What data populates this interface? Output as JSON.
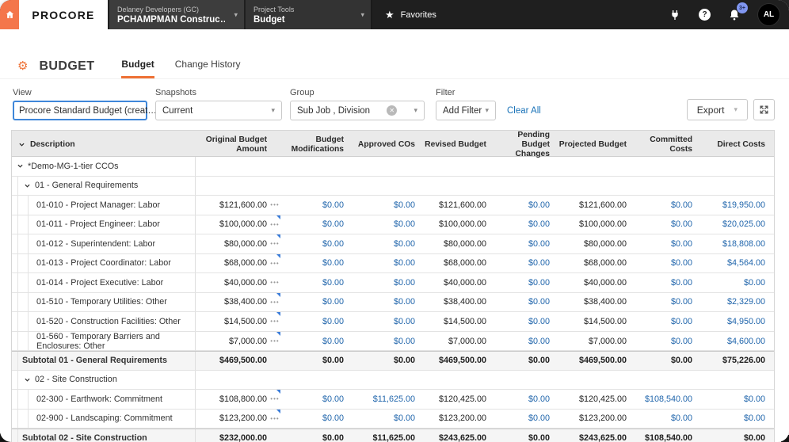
{
  "topbar": {
    "logo": "PROCORE",
    "company_label": "Delaney Developers (GC)",
    "company_value": "PCHAMPMAN Construc…",
    "tools_label": "Project Tools",
    "tools_value": "Budget",
    "favorites": "Favorites",
    "notification_badge": "3+",
    "avatar_initials": "AL"
  },
  "page": {
    "title": "BUDGET",
    "tabs": [
      {
        "label": "Budget",
        "active": true
      },
      {
        "label": "Change History",
        "active": false
      }
    ]
  },
  "filters": {
    "view_label": "View",
    "view_value": "Procore Standard Budget (creat…",
    "snapshots_label": "Snapshots",
    "snapshots_value": "Current",
    "group_label": "Group",
    "group_value": "Sub Job , Division",
    "filter_label": "Filter",
    "add_filter": "Add Filter",
    "clear_all": "Clear All",
    "export_label": "Export"
  },
  "icons": {
    "caret": "▾",
    "star": "★",
    "gear": "⚙",
    "question": "?",
    "clear": "✕",
    "ellipsis": "•••"
  },
  "colors": {
    "accent_orange": "#ee7135",
    "home_orange": "#f4764b",
    "link_blue": "#2166ac",
    "note_blue": "#3c7dd9",
    "badge_blue": "#8096f0",
    "topbar_bg": "#1f1f1f",
    "header_bg": "#eaeaea",
    "subtotal_bg": "#f5f5f5"
  },
  "table": {
    "columns": [
      "Description",
      "Original Budget Amount",
      "Budget Modifications",
      "Approved COs",
      "Revised Budget",
      "Pending Budget Changes",
      "Projected Budget",
      "Committed Costs",
      "Direct Costs"
    ],
    "rows": [
      {
        "type": "g1",
        "desc": "*Demo-MG-1-tier CCOs"
      },
      {
        "type": "g2",
        "desc": "01 - General Requirements"
      },
      {
        "type": "item",
        "desc": "01-010 - Project Manager: Labor",
        "note": false,
        "cells": [
          "$121,600.00",
          "$0.00",
          "$0.00",
          "$121,600.00",
          "$0.00",
          "$121,600.00",
          "$0.00",
          "$19,950.00"
        ]
      },
      {
        "type": "item",
        "desc": "01-011 - Project Engineer: Labor",
        "note": true,
        "cells": [
          "$100,000.00",
          "$0.00",
          "$0.00",
          "$100,000.00",
          "$0.00",
          "$100,000.00",
          "$0.00",
          "$20,025.00"
        ]
      },
      {
        "type": "item",
        "desc": "01-012 - Superintendent: Labor",
        "note": true,
        "cells": [
          "$80,000.00",
          "$0.00",
          "$0.00",
          "$80,000.00",
          "$0.00",
          "$80,000.00",
          "$0.00",
          "$18,808.00"
        ]
      },
      {
        "type": "item",
        "desc": "01-013 - Project Coordinator: Labor",
        "note": true,
        "cells": [
          "$68,000.00",
          "$0.00",
          "$0.00",
          "$68,000.00",
          "$0.00",
          "$68,000.00",
          "$0.00",
          "$4,564.00"
        ]
      },
      {
        "type": "item",
        "desc": "01-014 - Project Executive: Labor",
        "note": false,
        "cells": [
          "$40,000.00",
          "$0.00",
          "$0.00",
          "$40,000.00",
          "$0.00",
          "$40,000.00",
          "$0.00",
          "$0.00"
        ]
      },
      {
        "type": "item",
        "desc": "01-510 - Temporary Utilities: Other",
        "note": true,
        "cells": [
          "$38,400.00",
          "$0.00",
          "$0.00",
          "$38,400.00",
          "$0.00",
          "$38,400.00",
          "$0.00",
          "$2,329.00"
        ]
      },
      {
        "type": "item",
        "desc": "01-520 - Construction Facilities: Other",
        "note": true,
        "cells": [
          "$14,500.00",
          "$0.00",
          "$0.00",
          "$14,500.00",
          "$0.00",
          "$14,500.00",
          "$0.00",
          "$4,950.00"
        ]
      },
      {
        "type": "item",
        "desc": "01-560 - Temporary Barriers and Enclosures: Other",
        "note": true,
        "cells": [
          "$7,000.00",
          "$0.00",
          "$0.00",
          "$7,000.00",
          "$0.00",
          "$7,000.00",
          "$0.00",
          "$4,600.00"
        ]
      },
      {
        "type": "subtotal",
        "desc": "Subtotal 01 - General Requirements",
        "cells": [
          "$469,500.00",
          "$0.00",
          "$0.00",
          "$469,500.00",
          "$0.00",
          "$469,500.00",
          "$0.00",
          "$75,226.00"
        ]
      },
      {
        "type": "g2",
        "desc": "02 - Site Construction"
      },
      {
        "type": "item",
        "desc": "02-300 - Earthwork: Commitment",
        "note": true,
        "cells": [
          "$108,800.00",
          "$0.00",
          "$11,625.00",
          "$120,425.00",
          "$0.00",
          "$120,425.00",
          "$108,540.00",
          "$0.00"
        ]
      },
      {
        "type": "item",
        "desc": "02-900 - Landscaping: Commitment",
        "note": true,
        "cells": [
          "$123,200.00",
          "$0.00",
          "$0.00",
          "$123,200.00",
          "$0.00",
          "$123,200.00",
          "$0.00",
          "$0.00"
        ]
      },
      {
        "type": "subtotal",
        "desc": "Subtotal 02 - Site Construction",
        "cells": [
          "$232,000.00",
          "$0.00",
          "$11,625.00",
          "$243,625.00",
          "$0.00",
          "$243,625.00",
          "$108,540.00",
          "$0.00"
        ]
      }
    ]
  }
}
